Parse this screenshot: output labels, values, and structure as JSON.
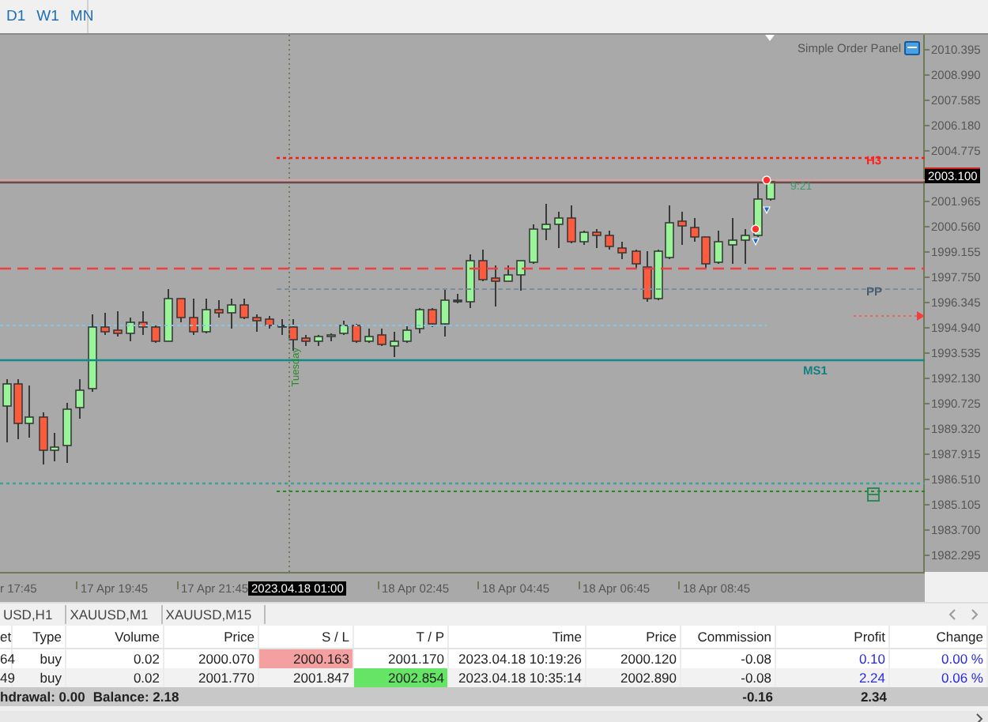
{
  "toolbar": {
    "tabs": [
      {
        "label": "D1"
      },
      {
        "label": "W1"
      },
      {
        "label": "MN"
      }
    ]
  },
  "chart": {
    "panel_label": "Simple Order Panel",
    "countdown": "9:21",
    "day_label": "Tuesday",
    "level_labels": [
      {
        "text": "H3",
        "kind": "resistance"
      },
      {
        "text": "PP",
        "kind": "pivot"
      },
      {
        "text": "MS1",
        "kind": "support"
      }
    ],
    "price_axis": [
      {
        "text": "2010.395",
        "kind": "tick"
      },
      {
        "text": "2008.990",
        "kind": "tick"
      },
      {
        "text": "2007.585",
        "kind": "tick"
      },
      {
        "text": "2006.180",
        "kind": "tick"
      },
      {
        "text": "2004.775",
        "kind": "tick"
      },
      {
        "text": "2003.100",
        "kind": "current"
      },
      {
        "text": "2001.965",
        "kind": "tick"
      },
      {
        "text": "2000.560",
        "kind": "tick"
      },
      {
        "text": "1999.155",
        "kind": "tick"
      },
      {
        "text": "1997.750",
        "kind": "tick"
      },
      {
        "text": "1996.345",
        "kind": "tick"
      },
      {
        "text": "1994.940",
        "kind": "tick"
      },
      {
        "text": "1993.535",
        "kind": "tick"
      },
      {
        "text": "1992.130",
        "kind": "tick"
      },
      {
        "text": "1990.725",
        "kind": "tick"
      },
      {
        "text": "1989.320",
        "kind": "tick"
      },
      {
        "text": "1987.915",
        "kind": "tick"
      },
      {
        "text": "1986.510",
        "kind": "tick"
      },
      {
        "text": "1985.105",
        "kind": "tick"
      },
      {
        "text": "1983.700",
        "kind": "tick"
      },
      {
        "text": "1982.295",
        "kind": "tick"
      }
    ],
    "time_axis": [
      {
        "text": "r 17:45",
        "kind": "cut"
      },
      {
        "text": "17 Apr 19:45",
        "kind": "tick"
      },
      {
        "text": "17 Apr 21:45",
        "kind": "tick"
      },
      {
        "text": "2023.04.18 01:00",
        "kind": "cursor"
      },
      {
        "text": "18 Apr 02:45",
        "kind": "tick"
      },
      {
        "text": "18 Apr 04:45",
        "kind": "tick"
      },
      {
        "text": "18 Apr 06:45",
        "kind": "tick"
      },
      {
        "text": "18 Apr 08:45",
        "kind": "tick"
      }
    ]
  },
  "terminal": {
    "tabs": [
      {
        "label": "USD,H1"
      },
      {
        "label": "XAUUSD,M1"
      },
      {
        "label": "XAUUSD,M15"
      }
    ],
    "columns": [
      {
        "label": "et",
        "kind": "text"
      },
      {
        "label": "Type",
        "kind": "text"
      },
      {
        "label": "Volume",
        "kind": "text"
      },
      {
        "label": "Price",
        "kind": "text"
      },
      {
        "label": "S / L",
        "kind": "sl"
      },
      {
        "label": "T / P",
        "kind": "tp"
      },
      {
        "label": "Time",
        "kind": "text"
      },
      {
        "label": "Price",
        "kind": "text"
      },
      {
        "label": "Commission",
        "kind": "text"
      },
      {
        "label": "Profit",
        "kind": "result"
      },
      {
        "label": "Change",
        "kind": "result"
      }
    ],
    "rows": [
      {
        "cells": [
          "64",
          "buy",
          "0.02",
          "2000.070",
          "2000.163",
          "2001.170",
          "2023.04.18 10:19:26",
          "2000.120",
          "-0.08",
          "0.10",
          "0.00 %"
        ],
        "sl_alert": true,
        "tp_alert": false
      },
      {
        "cells": [
          "49",
          "buy",
          "0.02",
          "2001.770",
          "2001.847",
          "2002.854",
          "2023.04.18 10:35:14",
          "2002.890",
          "-0.08",
          "2.24",
          "0.06 %"
        ],
        "sl_alert": false,
        "tp_alert": true
      }
    ],
    "summary": {
      "texts": [
        "hdrawal: 0.00",
        "Balance: 2.18"
      ],
      "commission": "-0.16",
      "profit": "2.34"
    }
  }
}
